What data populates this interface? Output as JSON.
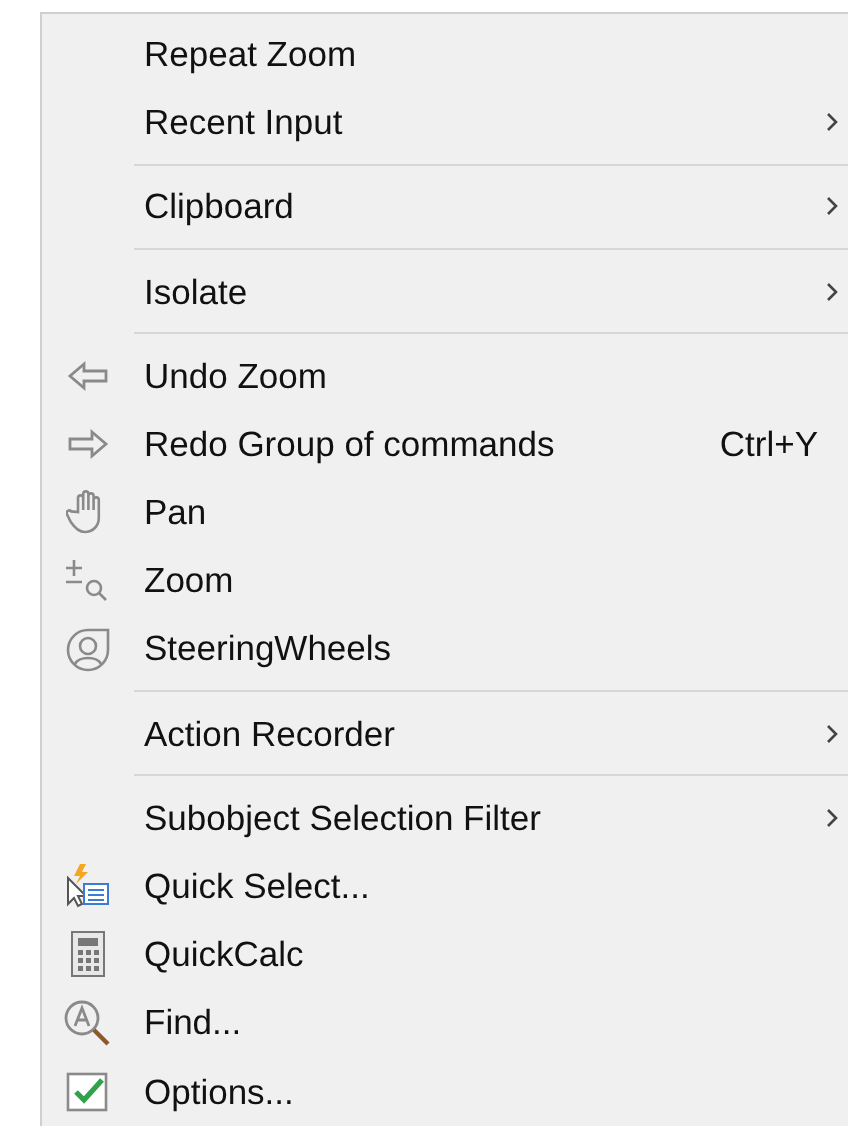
{
  "menu": {
    "groups": [
      {
        "items": [
          {
            "label": "Repeat Zoom",
            "submenu": false
          },
          {
            "label": "Recent Input",
            "submenu": true
          }
        ]
      },
      {
        "items": [
          {
            "label": "Clipboard",
            "submenu": true
          }
        ]
      },
      {
        "items": [
          {
            "label": "Isolate",
            "submenu": true
          }
        ]
      },
      {
        "items": [
          {
            "label": "Undo Zoom",
            "submenu": false
          },
          {
            "label": "Redo Group of commands",
            "shortcut": "Ctrl+Y",
            "submenu": false
          },
          {
            "label": "Pan",
            "submenu": false
          },
          {
            "label": "Zoom",
            "submenu": false
          },
          {
            "label": "SteeringWheels",
            "submenu": false
          }
        ]
      },
      {
        "items": [
          {
            "label": "Action Recorder",
            "submenu": true
          }
        ]
      },
      {
        "items": [
          {
            "label": "Subobject Selection Filter",
            "submenu": true
          },
          {
            "label": "Quick Select...",
            "submenu": false
          },
          {
            "label": "QuickCalc",
            "submenu": false
          },
          {
            "label": "Find...",
            "submenu": false
          },
          {
            "label": "Options...",
            "submenu": false
          }
        ]
      }
    ]
  }
}
